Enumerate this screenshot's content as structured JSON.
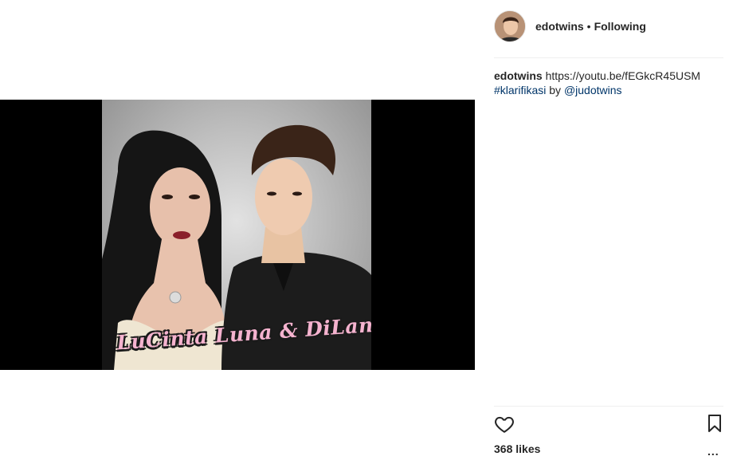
{
  "post": {
    "image_overlay_text": "LuCinta Luna & DiLan?",
    "header": {
      "username": "edotwins",
      "separator": "•",
      "follow_status": "Following"
    },
    "caption": {
      "username": "edotwins",
      "url": "https://youtu.be/fEGkcR45USM",
      "hashtag": "#klarifikasi",
      "by_text": "by",
      "mention": "@judotwins"
    },
    "actions": {
      "like_icon": "heart-outline-icon",
      "save_icon": "bookmark-icon",
      "more_icon": "more-dots-icon",
      "more_glyph": "..."
    },
    "likes_text": "368 likes"
  },
  "colors": {
    "text": "#262626",
    "link": "#003569",
    "media_background": "#000000",
    "overlay_text": "#f5b3cf"
  }
}
